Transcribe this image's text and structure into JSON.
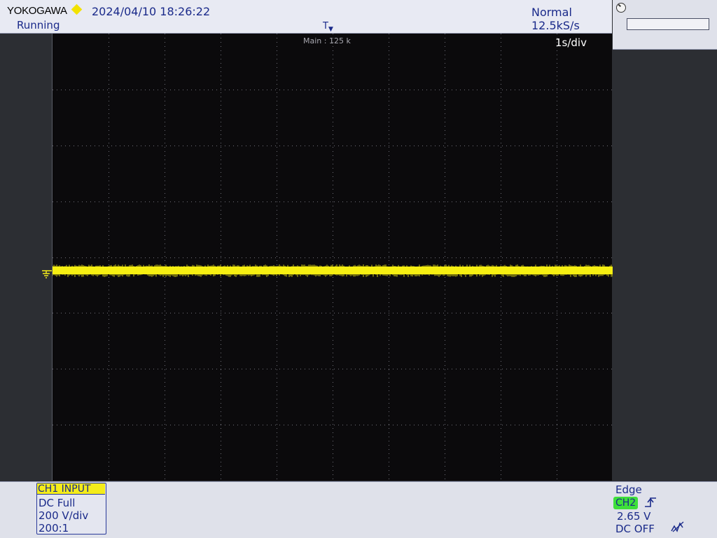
{
  "header": {
    "brand": "YOKOGAWA",
    "datetime": "2024/04/10 18:26:22",
    "run_status": "Running",
    "acq_mode": "Normal",
    "sample_rate": "12.5kS/s",
    "trigger_marker": "T"
  },
  "screen": {
    "main_zoom": "Main : 125 k",
    "timebase": "1s/div",
    "trace_color": "#f6ef12",
    "grid_color": "#6f6f78"
  },
  "channel1": {
    "header": "CH1  INPUT",
    "coupling": "DC Full",
    "scale": "200 V/div",
    "probe": "200:1",
    "color": "#f4ec1a"
  },
  "trigger": {
    "type": "Edge",
    "source": "CH2",
    "level": "2.65 V",
    "coupling": "DC OFF",
    "source_color": "#3ee03a",
    "slope_icon": "rising-edge-icon",
    "filter_icon": "hf-reject-icon"
  }
}
